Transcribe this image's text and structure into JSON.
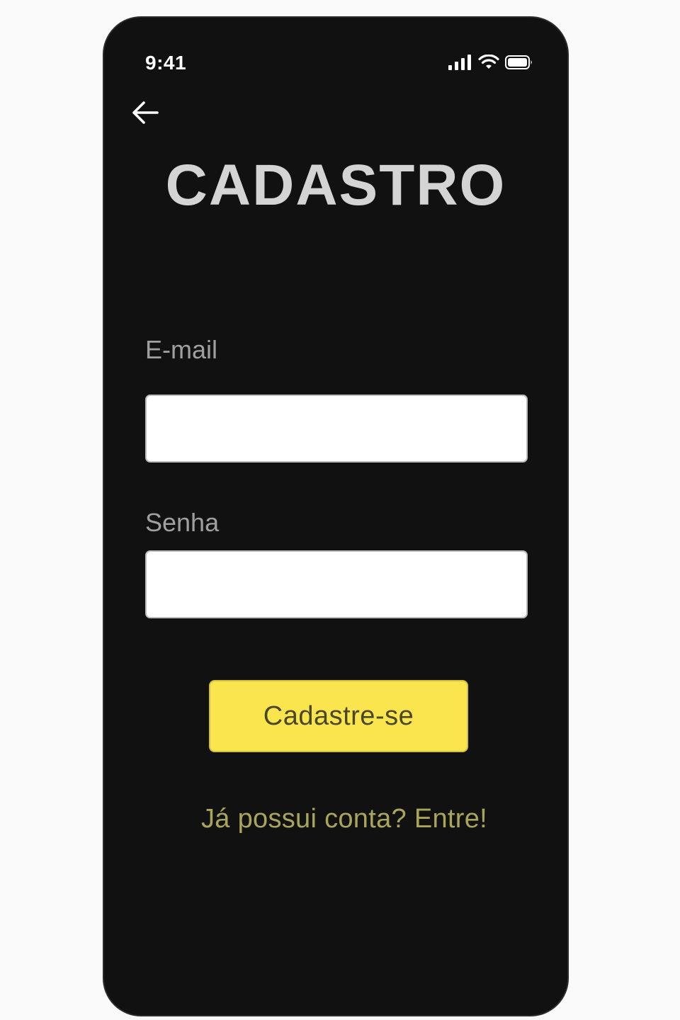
{
  "status_bar": {
    "time": "9:41",
    "icons": [
      "cellular-signal-icon",
      "wifi-icon",
      "battery-icon"
    ]
  },
  "navigation": {
    "back_icon": "arrow-left-icon"
  },
  "page": {
    "title": "CADASTRO"
  },
  "form": {
    "email_label": "E-mail",
    "email_value": "",
    "password_label": "Senha",
    "password_value": "",
    "submit_label": "Cadastre-se"
  },
  "footer": {
    "login_link": "Já possui conta? Entre!"
  },
  "colors": {
    "background": "#111111",
    "title": "#d4d4d4",
    "label": "#a0a0a0",
    "button": "#fbe54e",
    "button_text": "#4a4628",
    "link": "#a9a55a"
  }
}
